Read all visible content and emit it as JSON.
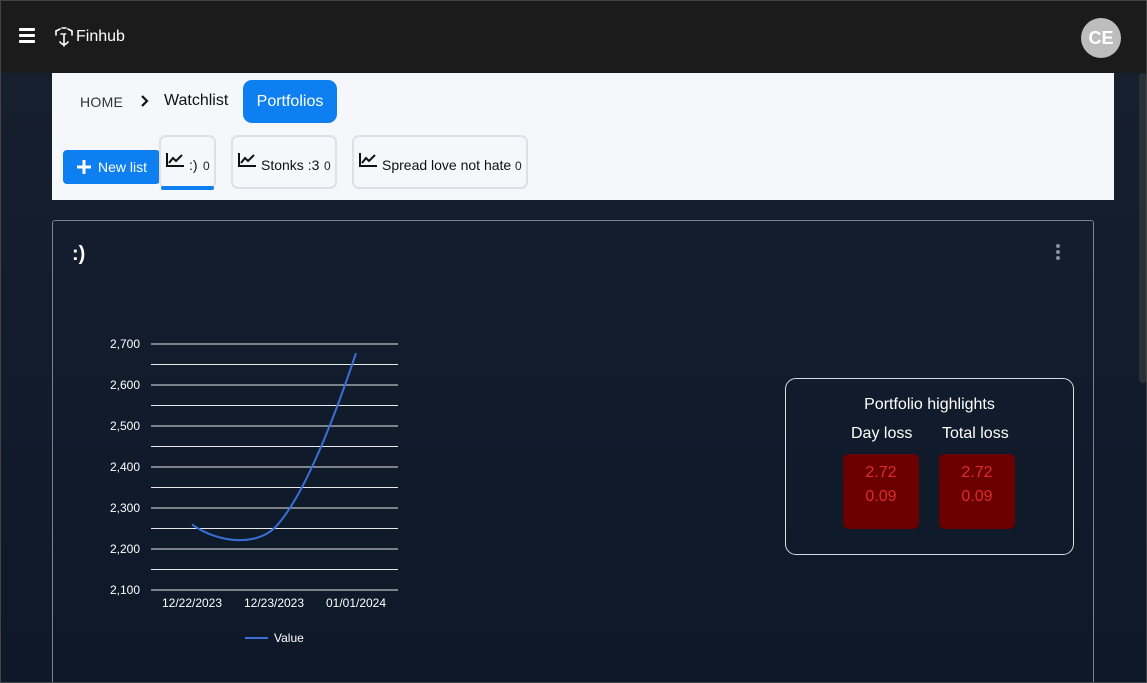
{
  "app": {
    "brand": "Finhub",
    "avatar_initials": "CE"
  },
  "breadcrumb": {
    "home": "HOME",
    "watchlist": "Watchlist",
    "portfolios": "Portfolios"
  },
  "toolbar": {
    "new_list_label": "New list"
  },
  "tabs": [
    {
      "name": ":)",
      "count": "0",
      "active": true
    },
    {
      "name": "Stonks :3",
      "count": "0",
      "active": false
    },
    {
      "name": "Spread love not hate",
      "count": "0",
      "active": false
    }
  ],
  "card": {
    "title": ":)"
  },
  "highlights": {
    "title": "Portfolio highlights",
    "day_loss_label": "Day loss",
    "total_loss_label": "Total loss",
    "day_loss_values": [
      "2.72",
      "0.09"
    ],
    "total_loss_values": [
      "2.72",
      "0.09"
    ],
    "loss_color": "#e02a2a",
    "loss_bg": "#6b0000"
  },
  "chart_data": {
    "type": "line",
    "categories": [
      "12/22/2023",
      "12/23/2023",
      "01/01/2024"
    ],
    "ytick_labels": [
      "2,100",
      "2,200",
      "2,300",
      "2,400",
      "2,500",
      "2,600",
      "2,700"
    ],
    "ylim": [
      2100,
      2700
    ],
    "grid": true,
    "legend": "bottom",
    "series": [
      {
        "name": "Value",
        "color": "#3a6fd8",
        "values": [
          2260,
          2250,
          2678
        ]
      }
    ]
  },
  "colors": {
    "accent": "#0d7ff0",
    "appbar": "#1b1b1b"
  }
}
